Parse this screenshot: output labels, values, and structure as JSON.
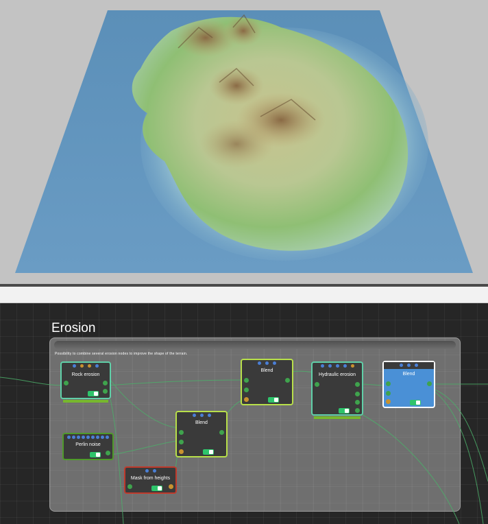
{
  "viewport": {
    "ground": "island-terrain-heightmap"
  },
  "graph": {
    "group": {
      "title": "Erosion",
      "description": "Possibility to combine several erosion nodes to improve the shape of the terrain."
    },
    "nodes": {
      "rock_erosion": {
        "title": "Rock erosion"
      },
      "perlin_noise": {
        "title": "Perlin noise"
      },
      "mask_from_heights": {
        "title": "Mask from heights"
      },
      "blend_1": {
        "title": "Blend"
      },
      "blend_2": {
        "title": "Blend"
      },
      "hydraulic_erosion": {
        "title": "Hydraulic erosion"
      },
      "blend_3": {
        "title": "Blend"
      }
    }
  },
  "colors": {
    "node_border_teal": "#5fd0a8",
    "node_border_green": "#4f9a2a",
    "node_border_lime": "#b8e04a",
    "node_border_red": "#c0392b",
    "selected_node_fill": "#4a90d6",
    "port_green": "#3fa34d",
    "port_orange": "#c8922f",
    "dot_blue": "#4a7fd6"
  }
}
